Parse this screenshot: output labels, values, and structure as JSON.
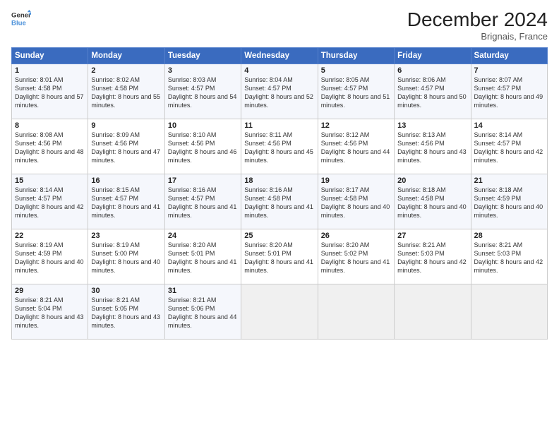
{
  "logo": {
    "line1": "General",
    "line2": "Blue"
  },
  "title": "December 2024",
  "location": "Brignais, France",
  "days_header": [
    "Sunday",
    "Monday",
    "Tuesday",
    "Wednesday",
    "Thursday",
    "Friday",
    "Saturday"
  ],
  "weeks": [
    [
      {
        "day": "1",
        "sunrise": "Sunrise: 8:01 AM",
        "sunset": "Sunset: 4:58 PM",
        "daylight": "Daylight: 8 hours and 57 minutes."
      },
      {
        "day": "2",
        "sunrise": "Sunrise: 8:02 AM",
        "sunset": "Sunset: 4:58 PM",
        "daylight": "Daylight: 8 hours and 55 minutes."
      },
      {
        "day": "3",
        "sunrise": "Sunrise: 8:03 AM",
        "sunset": "Sunset: 4:57 PM",
        "daylight": "Daylight: 8 hours and 54 minutes."
      },
      {
        "day": "4",
        "sunrise": "Sunrise: 8:04 AM",
        "sunset": "Sunset: 4:57 PM",
        "daylight": "Daylight: 8 hours and 52 minutes."
      },
      {
        "day": "5",
        "sunrise": "Sunrise: 8:05 AM",
        "sunset": "Sunset: 4:57 PM",
        "daylight": "Daylight: 8 hours and 51 minutes."
      },
      {
        "day": "6",
        "sunrise": "Sunrise: 8:06 AM",
        "sunset": "Sunset: 4:57 PM",
        "daylight": "Daylight: 8 hours and 50 minutes."
      },
      {
        "day": "7",
        "sunrise": "Sunrise: 8:07 AM",
        "sunset": "Sunset: 4:57 PM",
        "daylight": "Daylight: 8 hours and 49 minutes."
      }
    ],
    [
      {
        "day": "8",
        "sunrise": "Sunrise: 8:08 AM",
        "sunset": "Sunset: 4:56 PM",
        "daylight": "Daylight: 8 hours and 48 minutes."
      },
      {
        "day": "9",
        "sunrise": "Sunrise: 8:09 AM",
        "sunset": "Sunset: 4:56 PM",
        "daylight": "Daylight: 8 hours and 47 minutes."
      },
      {
        "day": "10",
        "sunrise": "Sunrise: 8:10 AM",
        "sunset": "Sunset: 4:56 PM",
        "daylight": "Daylight: 8 hours and 46 minutes."
      },
      {
        "day": "11",
        "sunrise": "Sunrise: 8:11 AM",
        "sunset": "Sunset: 4:56 PM",
        "daylight": "Daylight: 8 hours and 45 minutes."
      },
      {
        "day": "12",
        "sunrise": "Sunrise: 8:12 AM",
        "sunset": "Sunset: 4:56 PM",
        "daylight": "Daylight: 8 hours and 44 minutes."
      },
      {
        "day": "13",
        "sunrise": "Sunrise: 8:13 AM",
        "sunset": "Sunset: 4:56 PM",
        "daylight": "Daylight: 8 hours and 43 minutes."
      },
      {
        "day": "14",
        "sunrise": "Sunrise: 8:14 AM",
        "sunset": "Sunset: 4:57 PM",
        "daylight": "Daylight: 8 hours and 42 minutes."
      }
    ],
    [
      {
        "day": "15",
        "sunrise": "Sunrise: 8:14 AM",
        "sunset": "Sunset: 4:57 PM",
        "daylight": "Daylight: 8 hours and 42 minutes."
      },
      {
        "day": "16",
        "sunrise": "Sunrise: 8:15 AM",
        "sunset": "Sunset: 4:57 PM",
        "daylight": "Daylight: 8 hours and 41 minutes."
      },
      {
        "day": "17",
        "sunrise": "Sunrise: 8:16 AM",
        "sunset": "Sunset: 4:57 PM",
        "daylight": "Daylight: 8 hours and 41 minutes."
      },
      {
        "day": "18",
        "sunrise": "Sunrise: 8:16 AM",
        "sunset": "Sunset: 4:58 PM",
        "daylight": "Daylight: 8 hours and 41 minutes."
      },
      {
        "day": "19",
        "sunrise": "Sunrise: 8:17 AM",
        "sunset": "Sunset: 4:58 PM",
        "daylight": "Daylight: 8 hours and 40 minutes."
      },
      {
        "day": "20",
        "sunrise": "Sunrise: 8:18 AM",
        "sunset": "Sunset: 4:58 PM",
        "daylight": "Daylight: 8 hours and 40 minutes."
      },
      {
        "day": "21",
        "sunrise": "Sunrise: 8:18 AM",
        "sunset": "Sunset: 4:59 PM",
        "daylight": "Daylight: 8 hours and 40 minutes."
      }
    ],
    [
      {
        "day": "22",
        "sunrise": "Sunrise: 8:19 AM",
        "sunset": "Sunset: 4:59 PM",
        "daylight": "Daylight: 8 hours and 40 minutes."
      },
      {
        "day": "23",
        "sunrise": "Sunrise: 8:19 AM",
        "sunset": "Sunset: 5:00 PM",
        "daylight": "Daylight: 8 hours and 40 minutes."
      },
      {
        "day": "24",
        "sunrise": "Sunrise: 8:20 AM",
        "sunset": "Sunset: 5:01 PM",
        "daylight": "Daylight: 8 hours and 41 minutes."
      },
      {
        "day": "25",
        "sunrise": "Sunrise: 8:20 AM",
        "sunset": "Sunset: 5:01 PM",
        "daylight": "Daylight: 8 hours and 41 minutes."
      },
      {
        "day": "26",
        "sunrise": "Sunrise: 8:20 AM",
        "sunset": "Sunset: 5:02 PM",
        "daylight": "Daylight: 8 hours and 41 minutes."
      },
      {
        "day": "27",
        "sunrise": "Sunrise: 8:21 AM",
        "sunset": "Sunset: 5:03 PM",
        "daylight": "Daylight: 8 hours and 42 minutes."
      },
      {
        "day": "28",
        "sunrise": "Sunrise: 8:21 AM",
        "sunset": "Sunset: 5:03 PM",
        "daylight": "Daylight: 8 hours and 42 minutes."
      }
    ],
    [
      {
        "day": "29",
        "sunrise": "Sunrise: 8:21 AM",
        "sunset": "Sunset: 5:04 PM",
        "daylight": "Daylight: 8 hours and 43 minutes."
      },
      {
        "day": "30",
        "sunrise": "Sunrise: 8:21 AM",
        "sunset": "Sunset: 5:05 PM",
        "daylight": "Daylight: 8 hours and 43 minutes."
      },
      {
        "day": "31",
        "sunrise": "Sunrise: 8:21 AM",
        "sunset": "Sunset: 5:06 PM",
        "daylight": "Daylight: 8 hours and 44 minutes."
      },
      null,
      null,
      null,
      null
    ]
  ]
}
